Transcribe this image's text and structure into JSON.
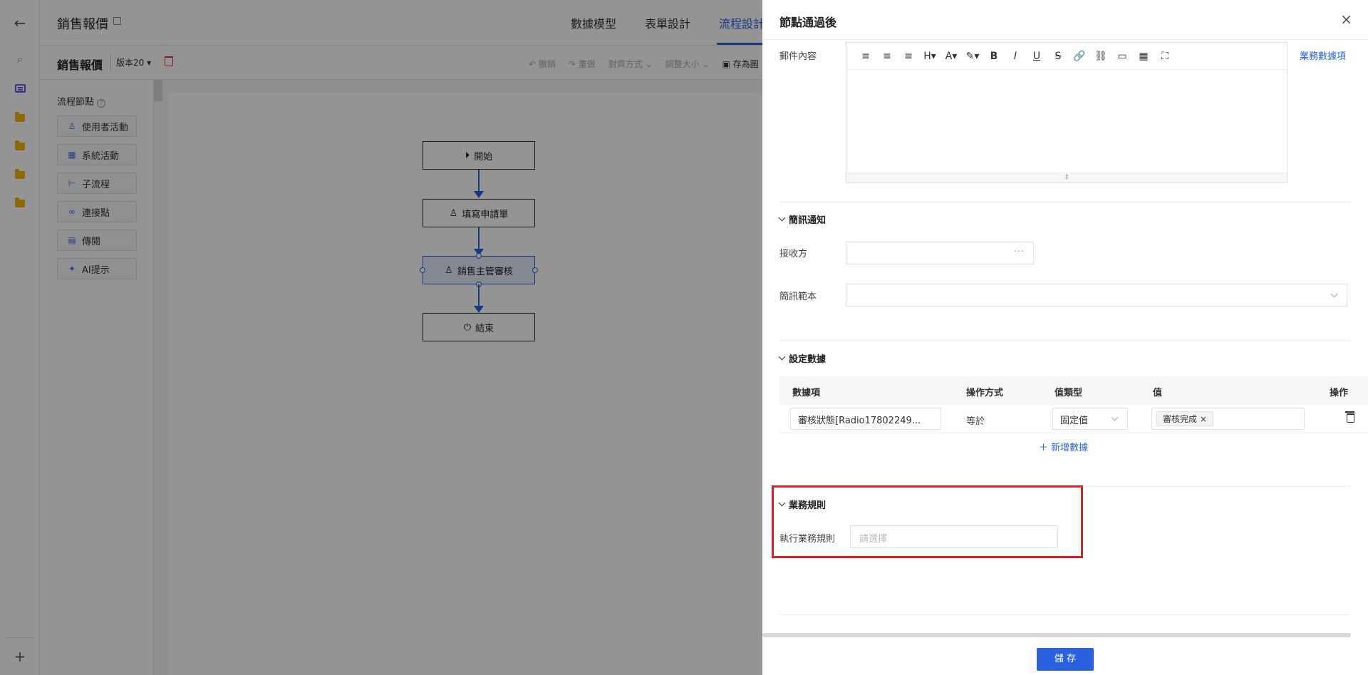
{
  "app": {
    "title": "銷售報價",
    "tabs": [
      "數據模型",
      "表單設計",
      "流程設計"
    ],
    "active_tab": "流程設計",
    "subtitle": "銷售報價",
    "version": "版本20 ▾",
    "toolbar": [
      "↶ 撤銷",
      "↷ 重做",
      "對齊方式 ⌄",
      "調整大小 ⌄"
    ],
    "save_image": "存為圖"
  },
  "palette": {
    "title": "流程節點",
    "items": [
      {
        "icon": "user-icon",
        "label": "使用者活動"
      },
      {
        "icon": "grid-icon",
        "label": "系統活動"
      },
      {
        "icon": "subprocess-icon",
        "label": "子流程"
      },
      {
        "icon": "link-icon",
        "label": "連接點"
      },
      {
        "icon": "document-icon",
        "label": "傳閱"
      },
      {
        "icon": "ai-icon",
        "label": "AI提示"
      }
    ]
  },
  "flow": {
    "nodes": [
      {
        "icon": "play-icon",
        "label": "開始"
      },
      {
        "icon": "user-icon",
        "label": "填寫申請單"
      },
      {
        "icon": "user-icon",
        "label": "銷售主管審核"
      },
      {
        "icon": "power-icon",
        "label": "結束"
      }
    ]
  },
  "drawer": {
    "title": "節點通過後",
    "close": "×",
    "mail_content_label": "郵件內容",
    "editor_tools": [
      "≡",
      "≡",
      "≡",
      "H▾",
      "A▾",
      "✎▾",
      "B",
      "I",
      "U",
      "S",
      "🔗",
      "⛓",
      "▭",
      "▦",
      "⛶"
    ],
    "biz_data_link": "業務數據項",
    "sms": {
      "title": "簡訊通知",
      "recipient_label": "接收方",
      "template_label": "簡訊範本"
    },
    "set_data": {
      "title": "設定數據",
      "columns": [
        "數據項",
        "操作方式",
        "值類型",
        "值",
        "操作"
      ],
      "row": {
        "item": "審核狀態[Radio17802249...",
        "op": "等於",
        "value_type": "固定值",
        "value_tag": "審核完成",
        "tag_remove": "×"
      },
      "add_label": "＋ 新增數據"
    },
    "biz_rules": {
      "title": "業務規則",
      "exec_label": "執行業務規則",
      "placeholder": "請選擇"
    },
    "save_button": "儲 存"
  },
  "colors": {
    "accent": "#2a61e0",
    "highlight": "#e02020",
    "folder": "#f5b400"
  }
}
